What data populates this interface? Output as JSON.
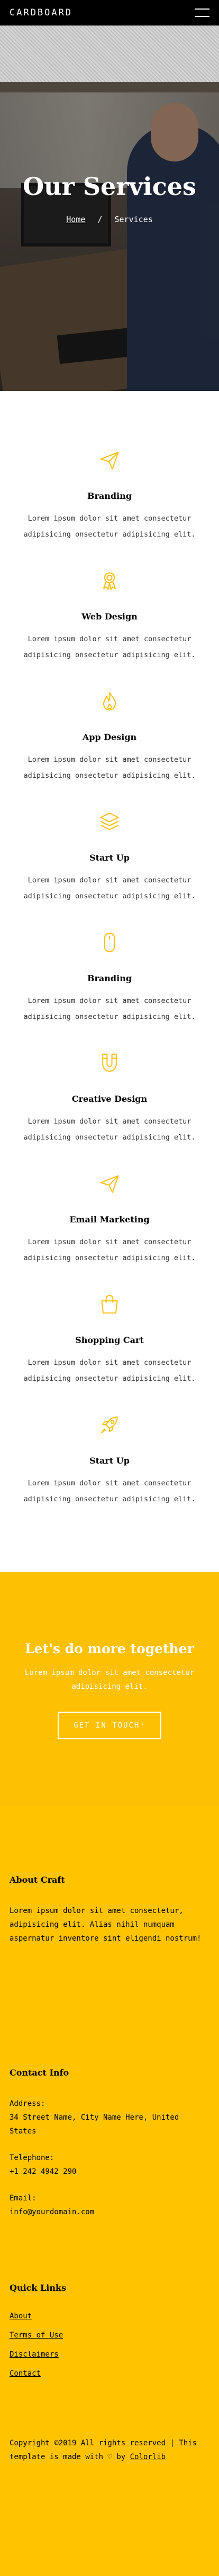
{
  "header": {
    "brand": "CARDBOARD",
    "menu_icon": "hamburger-icon"
  },
  "hero": {
    "title": "Our Services",
    "breadcrumb": {
      "home": "Home",
      "separator": "/",
      "current": "Services"
    }
  },
  "services": [
    {
      "icon": "paper-plane-icon",
      "title": "Branding",
      "text": "Lorem ipsum dolor sit amet consectetur adipisicing onsectetur adipisicing elit."
    },
    {
      "icon": "award-ribbon-icon",
      "title": "Web Design",
      "text": "Lorem ipsum dolor sit amet consectetur adipisicing onsectetur adipisicing elit."
    },
    {
      "icon": "flame-icon",
      "title": "App Design",
      "text": "Lorem ipsum dolor sit amet consectetur adipisicing onsectetur adipisicing elit."
    },
    {
      "icon": "layers-icon",
      "title": "Start Up",
      "text": "Lorem ipsum dolor sit amet consectetur adipisicing onsectetur adipisicing elit."
    },
    {
      "icon": "mouse-icon",
      "title": "Branding",
      "text": "Lorem ipsum dolor sit amet consectetur adipisicing onsectetur adipisicing elit."
    },
    {
      "icon": "magnet-icon",
      "title": "Creative Design",
      "text": "Lorem ipsum dolor sit amet consectetur adipisicing onsectetur adipisicing elit."
    },
    {
      "icon": "paper-plane-icon",
      "title": "Email Marketing",
      "text": "Lorem ipsum dolor sit amet consectetur adipisicing onsectetur adipisicing elit."
    },
    {
      "icon": "shopping-bag-icon",
      "title": "Shopping Cart",
      "text": "Lorem ipsum dolor sit amet consectetur adipisicing onsectetur adipisicing elit."
    },
    {
      "icon": "rocket-icon",
      "title": "Start Up",
      "text": "Lorem ipsum dolor sit amet consectetur adipisicing onsectetur adipisicing elit."
    }
  ],
  "cta": {
    "title": "Let's do more together",
    "text": "Lorem ipsum dolor sit amet consectetur adipisicing elit.",
    "button": "GET IN TOUCH!"
  },
  "footer": {
    "about_title": "About Craft",
    "about_text": "Lorem ipsum dolor sit amet consectetur, adipisicing elit. Alias nihil numquam aspernatur inventore sint eligendi nostrum!",
    "contact_title": "Contact Info",
    "address_label": "Address:",
    "address": "34 Street Name, City Name Here, United States",
    "telephone_label": "Telephone:",
    "telephone": "+1 242 4942 290",
    "email_label": "Email:",
    "email": "info@yourdomain.com",
    "links_title": "Quick Links",
    "links": [
      "About",
      "Terms of Use",
      "Disclaimers",
      "Contact"
    ],
    "copyright": "Copyright ©2019 All rights reserved | This template is made with",
    "heart": "♡",
    "by": "by",
    "credit": "Colorlib"
  },
  "colors": {
    "accent": "#fdc003",
    "header_bg": "#000000",
    "icon": "#fdc003"
  }
}
